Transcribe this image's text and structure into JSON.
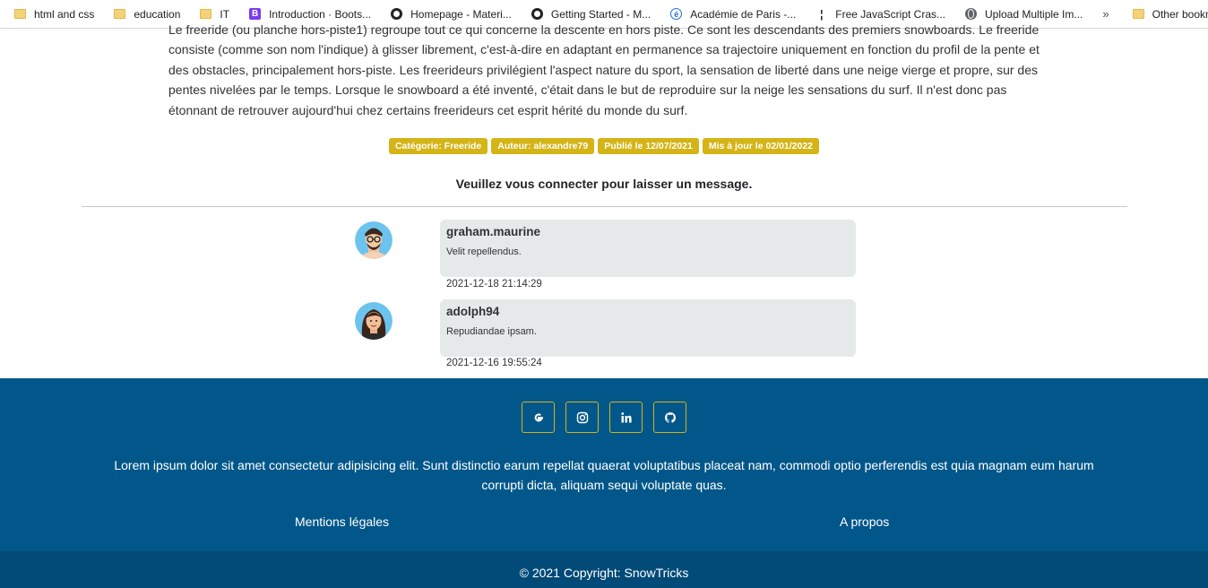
{
  "bookmarks": [
    {
      "label": "html and css",
      "icon": "folder-icon"
    },
    {
      "label": "education",
      "icon": "folder-icon"
    },
    {
      "label": "IT",
      "icon": "folder-icon"
    },
    {
      "label": "Introduction · Boots...",
      "icon": "bootstrap-icon"
    },
    {
      "label": "Homepage - Materi...",
      "icon": "github-icon"
    },
    {
      "label": "Getting Started - M...",
      "icon": "github-icon"
    },
    {
      "label": "Académie de Paris -...",
      "icon": "academie-icon"
    },
    {
      "label": "Free JavaScript Cras...",
      "icon": "js-icon"
    },
    {
      "label": "Upload Multiple Im...",
      "icon": "globe-icon"
    }
  ],
  "bookmarks_more": "»",
  "other_bookmarks": "Other bookmarks",
  "article": {
    "text": "Le freeride (ou planche hors-piste1) regroupe tout ce qui concerne la descente en hors piste. Ce sont les descendants des premiers snowboards. Le freeride consiste (comme son nom l'indique) à glisser librement, c'est-à-dire en adaptant en permanence sa trajectoire uniquement en fonction du profil de la pente et des obstacles, principalement hors-piste. Les freerideurs privilégient l'aspect nature du sport, la sensation de liberté dans une neige vierge et propre, sur des pentes nivelées par le temps. Lorsque le snowboard a été inventé, c'était dans le but de reproduire sur la neige les sensations du surf. Il n'est donc pas étonnant de retrouver aujourd'hui chez certains freerideurs cet esprit hérité du monde du surf."
  },
  "tags": [
    "Catégorie: Freeride",
    "Auteur: alexandre79",
    "Publié le 12/07/2021",
    "Mis à jour le 02/01/2022"
  ],
  "login_message": "Veuillez vous connecter pour laisser un message.",
  "comments": [
    {
      "author": "graham.maurine",
      "text": "Velit repellendus.",
      "date": "2021-12-18 21:14:29",
      "avatar": "male-avatar"
    },
    {
      "author": "adolph94",
      "text": "Repudiandae ipsam.",
      "date": "2021-12-16 19:55:24",
      "avatar": "female-avatar"
    }
  ],
  "footer": {
    "socials": [
      "google-icon",
      "instagram-icon",
      "linkedin-icon",
      "github-icon"
    ],
    "text": "Lorem ipsum dolor sit amet consectetur adipisicing elit. Sunt distinctio earum repellat quaerat voluptatibus placeat nam, commodi optio perferendis est quia magnam eum harum corrupti dicta, aliquam sequi voluptate quas.",
    "links": [
      "Mentions légales",
      "A propos"
    ],
    "copyright": "© 2021 Copyright: SnowTricks"
  },
  "colors": {
    "accent": "#d4b417",
    "footer_bg": "#02578a",
    "copyright_bg": "#024a77",
    "bubble_bg": "#e6e9ea"
  }
}
